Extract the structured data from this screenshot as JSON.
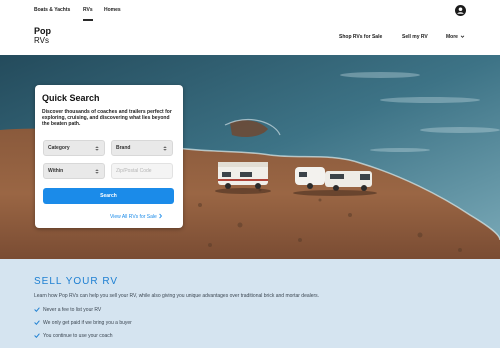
{
  "topbar": {
    "tabs": [
      {
        "label": "Boats & Yachts",
        "active": false
      },
      {
        "label": "RVs",
        "active": true
      },
      {
        "label": "Homes",
        "active": false
      }
    ],
    "user_icon": "user-circle-icon"
  },
  "brand": {
    "line1": "Pop",
    "line2": "RVs"
  },
  "nav": {
    "shop": "Shop RVs for Sale",
    "sell": "Sell my RV",
    "more": "More"
  },
  "search": {
    "title": "Quick Search",
    "description": "Discover thousands of coaches and trailers perfect for exploring, cruising, and discovering what lies beyond the beaten path.",
    "category": "Category",
    "brand": "Brand",
    "within": "Within",
    "zip_placeholder": "Zip/Postal Code",
    "button": "Search",
    "view_all": "View All RVs for Sale"
  },
  "sell": {
    "heading": "SELL YOUR RV",
    "intro": "Learn how Pop RVs can help you sell your RV, while also giving you unique advantages over traditional brick and mortar dealers.",
    "benefits": [
      "Never a fee to list your RV",
      "We only get paid if we bring you a buyer",
      "You continue to use your coach"
    ]
  },
  "colors": {
    "accent": "#1b8be9",
    "sell_bg": "#d5e4f0",
    "heading": "#1d7fd2"
  }
}
